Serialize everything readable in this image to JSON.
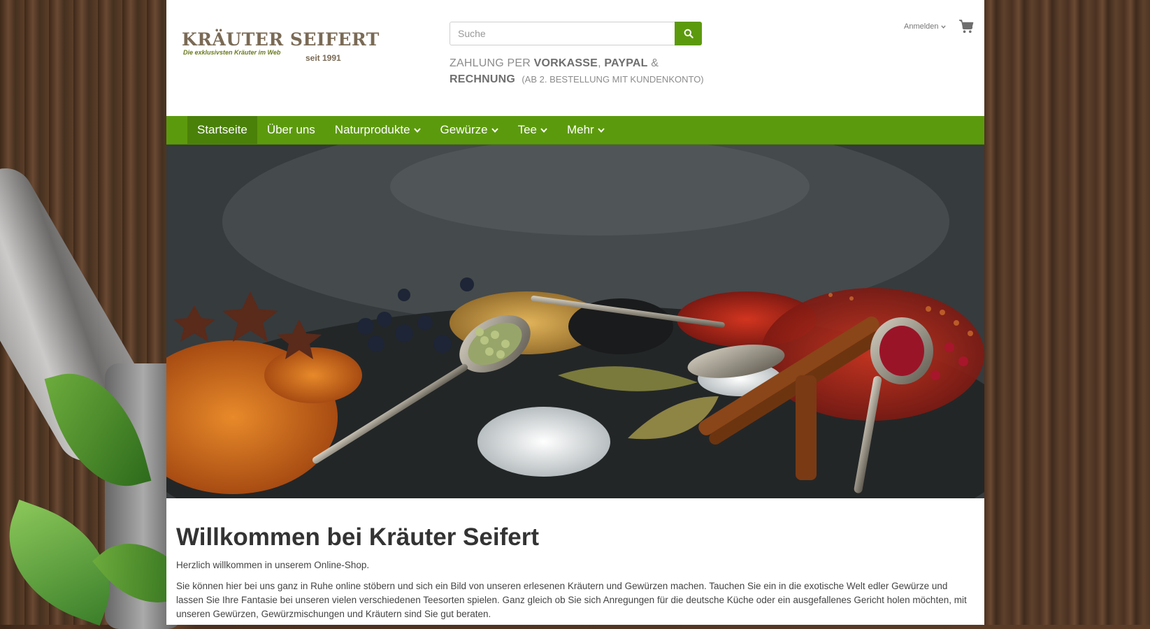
{
  "brand": {
    "name": "KRÄUTER SEIFERT",
    "tagline": "Die exklusivsten Kräuter im Web",
    "since": "seit 1991"
  },
  "search": {
    "placeholder": "Suche",
    "button_icon": "search-icon"
  },
  "payment": {
    "prefix": "ZAHLUNG PER",
    "method1": "VORKASSE",
    "sep1": ",",
    "method2": "PAYPAL",
    "sep2": "&",
    "method3": "RECHNUNG",
    "note": "(AB 2. BESTELLUNG MIT KUNDENKONTO)"
  },
  "account": {
    "login_label": "Anmelden",
    "cart_icon": "shopping-cart-icon"
  },
  "nav": {
    "items": [
      {
        "label": "Startseite",
        "active": true,
        "dropdown": false
      },
      {
        "label": "Über uns",
        "active": false,
        "dropdown": false
      },
      {
        "label": "Naturprodukte",
        "active": false,
        "dropdown": true
      },
      {
        "label": "Gewürze",
        "active": false,
        "dropdown": true
      },
      {
        "label": "Tee",
        "active": false,
        "dropdown": true
      },
      {
        "label": "Mehr",
        "active": false,
        "dropdown": true
      }
    ]
  },
  "hero": {
    "image_description": "Spices on a dark slate surface"
  },
  "welcome": {
    "title": "Willkommen bei Kräuter Seifert",
    "intro": "Herzlich willkommen in unserem Online-Shop.",
    "body": "Sie können hier bei uns ganz in Ruhe online stöbern und sich ein Bild von unseren erlesenen Kräutern und Gewürzen machen. Tauchen Sie ein in die exotische Welt edler Gewürze und lassen Sie Ihre Fantasie bei unseren vielen verschiedenen Teesorten spielen. Ganz gleich ob Sie sich Anregungen für die deutsche Küche oder ein ausgefallenes Gericht holen möchten, mit unseren Gewürzen, Gewürzmischungen und Kräutern sind Sie gut beraten."
  },
  "colors": {
    "accent_green": "#5c9a0d",
    "nav_active": "#4a8109",
    "logo_brown": "#7a6a55",
    "tagline_green": "#6a7a1e"
  }
}
